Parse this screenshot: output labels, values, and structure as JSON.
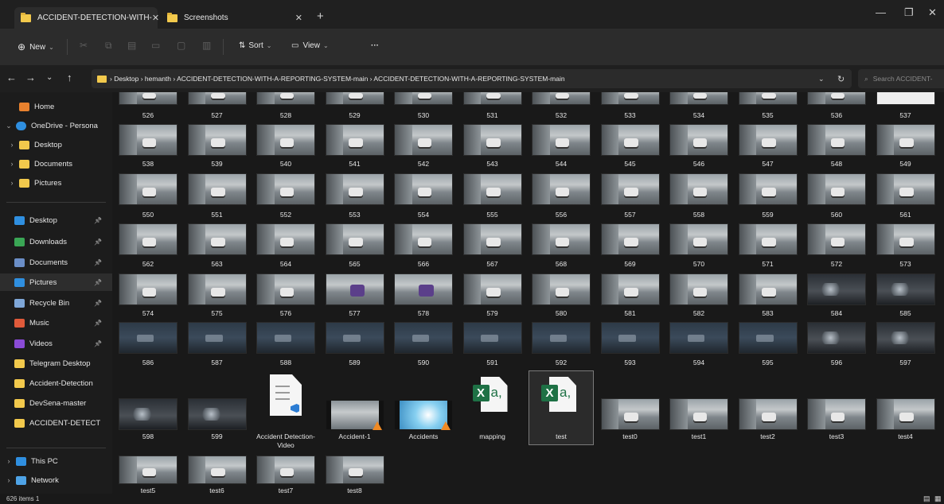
{
  "tabs": [
    {
      "label": "ACCIDENT-DETECTION-WITH-",
      "active": true
    },
    {
      "label": "Screenshots",
      "active": false
    }
  ],
  "toolbar": {
    "new_label": "New",
    "sort_label": "Sort",
    "view_label": "View",
    "more_label": "···"
  },
  "address": {
    "path": "›  Desktop  ›  hemanth  ›  ACCIDENT-DETECTION-WITH-A-REPORTING-SYSTEM-main  ›  ACCIDENT-DETECTION-WITH-A-REPORTING-SYSTEM-main",
    "search_placeholder": "Search ACCIDENT-"
  },
  "sidebar": {
    "home": "Home",
    "onedrive": "OneDrive - Persona",
    "onedrive_children": [
      "Desktop",
      "Documents",
      "Pictures"
    ],
    "quick_access": [
      {
        "label": "Desktop",
        "icon": "desktop-icon",
        "color": "#2f8fe0"
      },
      {
        "label": "Downloads",
        "icon": "download-icon",
        "color": "#3aa655"
      },
      {
        "label": "Documents",
        "icon": "documents-icon",
        "color": "#6b8ec7"
      },
      {
        "label": "Pictures",
        "icon": "pictures-icon",
        "color": "#2f8fe0"
      },
      {
        "label": "Recycle Bin",
        "icon": "recycle-bin-icon",
        "color": "#7fa7d8"
      },
      {
        "label": "Music",
        "icon": "music-icon",
        "color": "#e05a3a"
      },
      {
        "label": "Videos",
        "icon": "videos-icon",
        "color": "#8a4bd6"
      },
      {
        "label": "Telegram Desktop",
        "icon": "folder-icon",
        "color": "#f2c94c"
      },
      {
        "label": "Accident-Detection",
        "icon": "folder-icon",
        "color": "#f2c94c"
      },
      {
        "label": "DevSena-master",
        "icon": "folder-icon",
        "color": "#f2c94c"
      },
      {
        "label": "ACCIDENT-DETECT",
        "icon": "folder-icon",
        "color": "#f2c94c"
      }
    ],
    "this_pc": "This PC",
    "network": "Network"
  },
  "rows": [
    {
      "items": [
        "526",
        "527",
        "528",
        "529",
        "530",
        "531",
        "532",
        "533",
        "534",
        "535",
        "536",
        "537"
      ],
      "style": [
        "street",
        "street",
        "street",
        "street",
        "street",
        "street",
        "street",
        "street",
        "street",
        "street",
        "street",
        "white"
      ]
    },
    {
      "items": [
        "538",
        "539",
        "540",
        "541",
        "542",
        "543",
        "544",
        "545",
        "546",
        "547",
        "548",
        "549"
      ],
      "style": [
        "street",
        "street",
        "street",
        "street",
        "street",
        "street",
        "street",
        "street",
        "street",
        "street",
        "street",
        "street"
      ]
    },
    {
      "items": [
        "550",
        "551",
        "552",
        "553",
        "554",
        "555",
        "556",
        "557",
        "558",
        "559",
        "560",
        "561"
      ],
      "style": [
        "street",
        "street",
        "street",
        "street",
        "street",
        "street",
        "street",
        "street",
        "street",
        "street",
        "street",
        "street"
      ]
    },
    {
      "items": [
        "562",
        "563",
        "564",
        "565",
        "566",
        "567",
        "568",
        "569",
        "570",
        "571",
        "572",
        "573"
      ],
      "style": [
        "street",
        "street",
        "street",
        "street",
        "street",
        "street",
        "street",
        "street",
        "street",
        "street",
        "street",
        "street"
      ]
    },
    {
      "items": [
        "574",
        "575",
        "576",
        "577",
        "578",
        "579",
        "580",
        "581",
        "582",
        "583",
        "584",
        "585"
      ],
      "style": [
        "street",
        "street",
        "street",
        "purple",
        "purple",
        "street",
        "street",
        "street",
        "street",
        "street",
        "night",
        "night"
      ]
    },
    {
      "items": [
        "586",
        "587",
        "588",
        "589",
        "590",
        "591",
        "592",
        "593",
        "594",
        "595",
        "596",
        "597"
      ],
      "style": [
        "dark",
        "dark",
        "dark",
        "dark",
        "dark",
        "dark",
        "dark",
        "dark",
        "dark",
        "dark",
        "night",
        "night"
      ]
    }
  ],
  "row7": [
    {
      "label": "598",
      "kind": "thumb",
      "style": "night"
    },
    {
      "label": "599",
      "kind": "thumb",
      "style": "night"
    },
    {
      "label": "Accident Detection-Video",
      "kind": "vscode"
    },
    {
      "label": "Accident-1",
      "kind": "video"
    },
    {
      "label": "Accidents",
      "kind": "video-sky"
    },
    {
      "label": "mapping",
      "kind": "excel"
    },
    {
      "label": "test",
      "kind": "excel",
      "selected": true
    },
    {
      "label": "test0",
      "kind": "thumb",
      "style": "street"
    },
    {
      "label": "test1",
      "kind": "thumb",
      "style": "street"
    },
    {
      "label": "test2",
      "kind": "thumb",
      "style": "street"
    },
    {
      "label": "test3",
      "kind": "thumb",
      "style": "street"
    },
    {
      "label": "test4",
      "kind": "thumb",
      "style": "street"
    }
  ],
  "row8": [
    {
      "label": "test5",
      "style": "street"
    },
    {
      "label": "test6",
      "style": "street"
    },
    {
      "label": "test7",
      "style": "street"
    },
    {
      "label": "test8",
      "style": "street"
    }
  ],
  "status": {
    "text": "626 items  1"
  }
}
